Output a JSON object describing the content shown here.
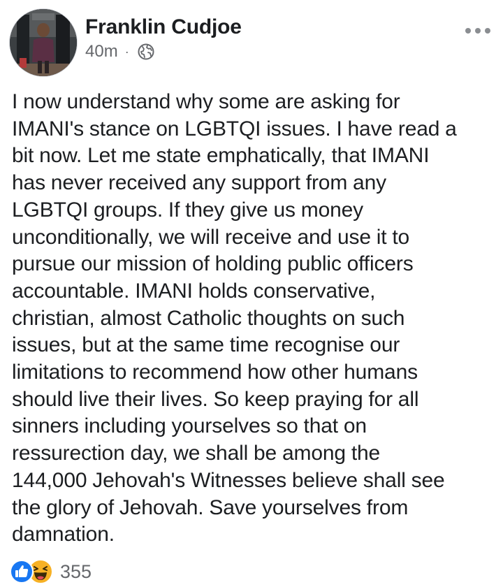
{
  "post": {
    "author": "Franklin Cudjoe",
    "time": "40m",
    "separator": "·",
    "privacy_icon": "globe-icon",
    "menu_icon": "more-horizontal-icon",
    "body": "I now understand why some are asking for\nIMANI's stance on LGBTQI issues. I have read a\nbit now.  Let me state emphatically, that IMANI\nhas never received any support from any\nLGBTQI groups. If they give us money\nunconditionally, we will receive and use it to\npursue our mission of holding public officers\naccountable.  IMANI holds conservative,\nchristian,  almost Catholic thoughts on such\nissues, but at the same time recognise our\nlimitations to recommend how other humans\nshould live their lives. So keep praying for all\nsinners including yourselves so that on\nressurection day, we shall be among the\n144,000  Jehovah's Witnesses believe shall see\nthe glory of Jehovah. Save yourselves from\ndamnation.",
    "reactions": {
      "icons": [
        "like-icon",
        "haha-icon"
      ],
      "count": "355"
    }
  },
  "colors": {
    "text": "#1c1e21",
    "secondary_text": "#65676b",
    "like_blue": "#1877f2",
    "haha_yellow": "#f7b125"
  }
}
